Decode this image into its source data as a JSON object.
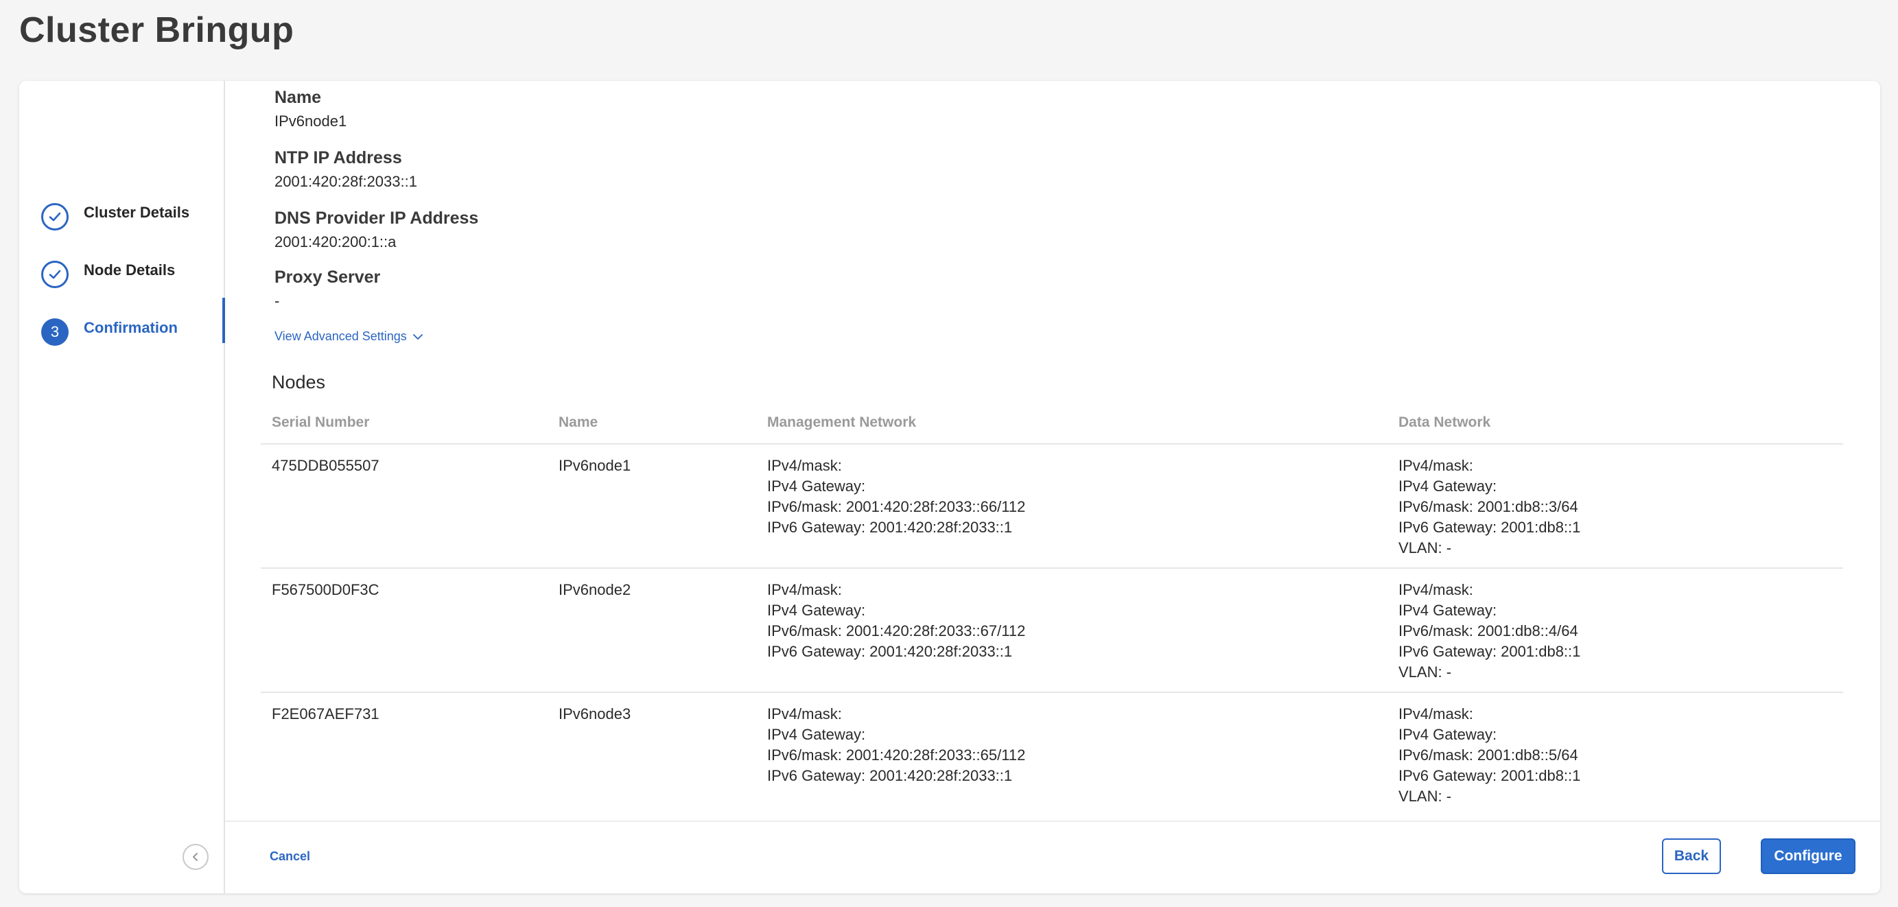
{
  "page": {
    "title": "Cluster Bringup"
  },
  "stepper": {
    "steps": [
      {
        "label": "Cluster Details",
        "state": "complete",
        "icon": "check-icon"
      },
      {
        "label": "Node Details",
        "state": "complete",
        "icon": "check-icon"
      },
      {
        "label": "Confirmation",
        "state": "current",
        "number": "3"
      }
    ],
    "collapse_icon": "chevron-left-icon"
  },
  "summary": {
    "fields": [
      {
        "label": "Name",
        "value": "IPv6node1"
      },
      {
        "label": "NTP IP Address",
        "value": "2001:420:28f:2033::1"
      },
      {
        "label": "DNS Provider IP Address",
        "value": "2001:420:200:1::a"
      },
      {
        "label": "Proxy Server",
        "value": "-"
      }
    ],
    "advanced_link": "View Advanced Settings"
  },
  "nodes": {
    "title": "Nodes",
    "columns": [
      "Serial Number",
      "Name",
      "Management Network",
      "Data Network"
    ],
    "rows": [
      {
        "serial": "475DDB055507",
        "name": "IPv6node1",
        "management": [
          "IPv4/mask:",
          "IPv4 Gateway:",
          "IPv6/mask: 2001:420:28f:2033::66/112",
          "IPv6 Gateway: 2001:420:28f:2033::1"
        ],
        "data": [
          "IPv4/mask:",
          "IPv4 Gateway:",
          "IPv6/mask: 2001:db8::3/64",
          "IPv6 Gateway: 2001:db8::1",
          "VLAN: -"
        ]
      },
      {
        "serial": "F567500D0F3C",
        "name": "IPv6node2",
        "management": [
          "IPv4/mask:",
          "IPv4 Gateway:",
          "IPv6/mask: 2001:420:28f:2033::67/112",
          "IPv6 Gateway: 2001:420:28f:2033::1"
        ],
        "data": [
          "IPv4/mask:",
          "IPv4 Gateway:",
          "IPv6/mask: 2001:db8::4/64",
          "IPv6 Gateway: 2001:db8::1",
          "VLAN: -"
        ]
      },
      {
        "serial": "F2E067AEF731",
        "name": "IPv6node3",
        "management": [
          "IPv4/mask:",
          "IPv4 Gateway:",
          "IPv6/mask: 2001:420:28f:2033::65/112",
          "IPv6 Gateway: 2001:420:28f:2033::1"
        ],
        "data": [
          "IPv4/mask:",
          "IPv4 Gateway:",
          "IPv6/mask: 2001:db8::5/64",
          "IPv6 Gateway: 2001:db8::1",
          "VLAN: -"
        ]
      }
    ]
  },
  "footer": {
    "cancel": "Cancel",
    "back": "Back",
    "configure": "Configure"
  },
  "colors": {
    "accent": "#2b65c2",
    "background": "#f5f5f5"
  }
}
